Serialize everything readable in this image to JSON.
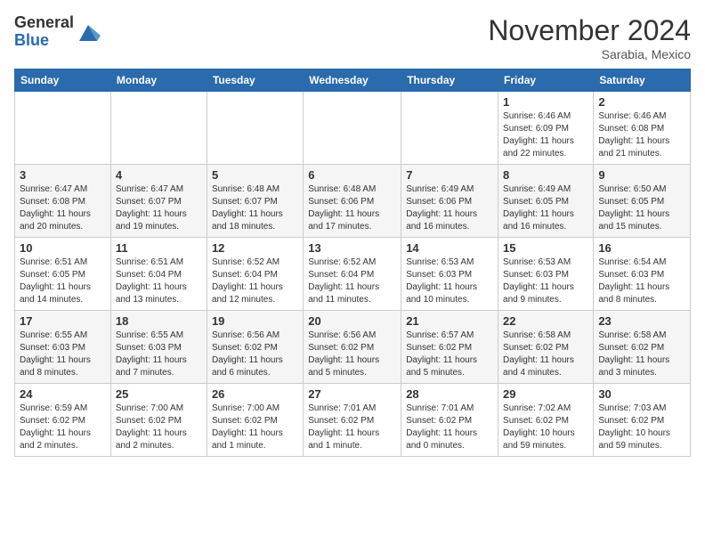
{
  "logo": {
    "general": "General",
    "blue": "Blue"
  },
  "title": "November 2024",
  "location": "Sarabia, Mexico",
  "days_of_week": [
    "Sunday",
    "Monday",
    "Tuesday",
    "Wednesday",
    "Thursday",
    "Friday",
    "Saturday"
  ],
  "weeks": [
    [
      {
        "day": "",
        "info": ""
      },
      {
        "day": "",
        "info": ""
      },
      {
        "day": "",
        "info": ""
      },
      {
        "day": "",
        "info": ""
      },
      {
        "day": "",
        "info": ""
      },
      {
        "day": "1",
        "info": "Sunrise: 6:46 AM\nSunset: 6:09 PM\nDaylight: 11 hours\nand 22 minutes."
      },
      {
        "day": "2",
        "info": "Sunrise: 6:46 AM\nSunset: 6:08 PM\nDaylight: 11 hours\nand 21 minutes."
      }
    ],
    [
      {
        "day": "3",
        "info": "Sunrise: 6:47 AM\nSunset: 6:08 PM\nDaylight: 11 hours\nand 20 minutes."
      },
      {
        "day": "4",
        "info": "Sunrise: 6:47 AM\nSunset: 6:07 PM\nDaylight: 11 hours\nand 19 minutes."
      },
      {
        "day": "5",
        "info": "Sunrise: 6:48 AM\nSunset: 6:07 PM\nDaylight: 11 hours\nand 18 minutes."
      },
      {
        "day": "6",
        "info": "Sunrise: 6:48 AM\nSunset: 6:06 PM\nDaylight: 11 hours\nand 17 minutes."
      },
      {
        "day": "7",
        "info": "Sunrise: 6:49 AM\nSunset: 6:06 PM\nDaylight: 11 hours\nand 16 minutes."
      },
      {
        "day": "8",
        "info": "Sunrise: 6:49 AM\nSunset: 6:05 PM\nDaylight: 11 hours\nand 16 minutes."
      },
      {
        "day": "9",
        "info": "Sunrise: 6:50 AM\nSunset: 6:05 PM\nDaylight: 11 hours\nand 15 minutes."
      }
    ],
    [
      {
        "day": "10",
        "info": "Sunrise: 6:51 AM\nSunset: 6:05 PM\nDaylight: 11 hours\nand 14 minutes."
      },
      {
        "day": "11",
        "info": "Sunrise: 6:51 AM\nSunset: 6:04 PM\nDaylight: 11 hours\nand 13 minutes."
      },
      {
        "day": "12",
        "info": "Sunrise: 6:52 AM\nSunset: 6:04 PM\nDaylight: 11 hours\nand 12 minutes."
      },
      {
        "day": "13",
        "info": "Sunrise: 6:52 AM\nSunset: 6:04 PM\nDaylight: 11 hours\nand 11 minutes."
      },
      {
        "day": "14",
        "info": "Sunrise: 6:53 AM\nSunset: 6:03 PM\nDaylight: 11 hours\nand 10 minutes."
      },
      {
        "day": "15",
        "info": "Sunrise: 6:53 AM\nSunset: 6:03 PM\nDaylight: 11 hours\nand 9 minutes."
      },
      {
        "day": "16",
        "info": "Sunrise: 6:54 AM\nSunset: 6:03 PM\nDaylight: 11 hours\nand 8 minutes."
      }
    ],
    [
      {
        "day": "17",
        "info": "Sunrise: 6:55 AM\nSunset: 6:03 PM\nDaylight: 11 hours\nand 8 minutes."
      },
      {
        "day": "18",
        "info": "Sunrise: 6:55 AM\nSunset: 6:03 PM\nDaylight: 11 hours\nand 7 minutes."
      },
      {
        "day": "19",
        "info": "Sunrise: 6:56 AM\nSunset: 6:02 PM\nDaylight: 11 hours\nand 6 minutes."
      },
      {
        "day": "20",
        "info": "Sunrise: 6:56 AM\nSunset: 6:02 PM\nDaylight: 11 hours\nand 5 minutes."
      },
      {
        "day": "21",
        "info": "Sunrise: 6:57 AM\nSunset: 6:02 PM\nDaylight: 11 hours\nand 5 minutes."
      },
      {
        "day": "22",
        "info": "Sunrise: 6:58 AM\nSunset: 6:02 PM\nDaylight: 11 hours\nand 4 minutes."
      },
      {
        "day": "23",
        "info": "Sunrise: 6:58 AM\nSunset: 6:02 PM\nDaylight: 11 hours\nand 3 minutes."
      }
    ],
    [
      {
        "day": "24",
        "info": "Sunrise: 6:59 AM\nSunset: 6:02 PM\nDaylight: 11 hours\nand 2 minutes."
      },
      {
        "day": "25",
        "info": "Sunrise: 7:00 AM\nSunset: 6:02 PM\nDaylight: 11 hours\nand 2 minutes."
      },
      {
        "day": "26",
        "info": "Sunrise: 7:00 AM\nSunset: 6:02 PM\nDaylight: 11 hours\nand 1 minute."
      },
      {
        "day": "27",
        "info": "Sunrise: 7:01 AM\nSunset: 6:02 PM\nDaylight: 11 hours\nand 1 minute."
      },
      {
        "day": "28",
        "info": "Sunrise: 7:01 AM\nSunset: 6:02 PM\nDaylight: 11 hours\nand 0 minutes."
      },
      {
        "day": "29",
        "info": "Sunrise: 7:02 AM\nSunset: 6:02 PM\nDaylight: 10 hours\nand 59 minutes."
      },
      {
        "day": "30",
        "info": "Sunrise: 7:03 AM\nSunset: 6:02 PM\nDaylight: 10 hours\nand 59 minutes."
      }
    ]
  ]
}
